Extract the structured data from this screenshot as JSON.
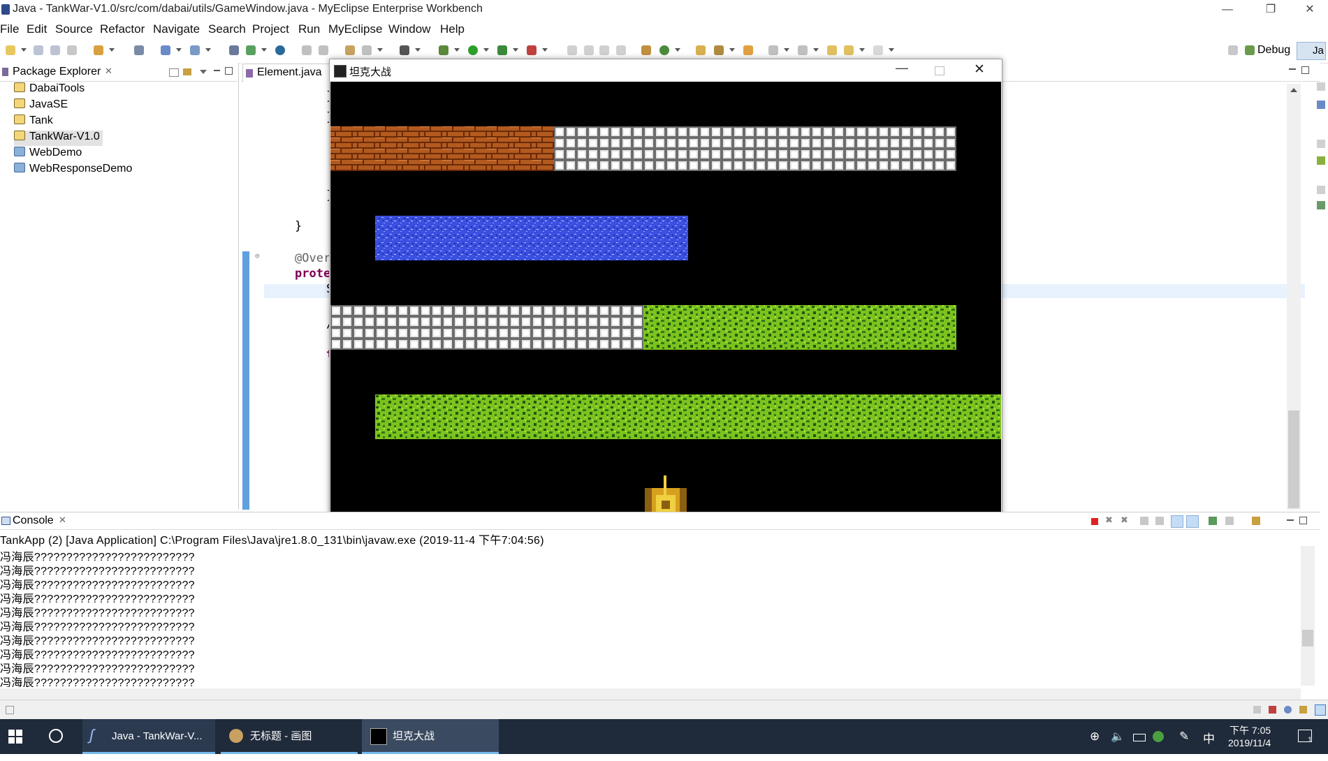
{
  "window": {
    "title": "Java - TankWar-V1.0/src/com/dabai/utils/GameWindow.java - MyEclipse Enterprise Workbench",
    "minimize": "—",
    "restore": "❐",
    "close": "✕"
  },
  "menu": [
    "File",
    "Edit",
    "Source",
    "Refactor",
    "Navigate",
    "Search",
    "Project",
    "Run",
    "MyEclipse",
    "Window",
    "Help"
  ],
  "perspectives": {
    "debug": "Debug",
    "java": "Ja"
  },
  "package_explorer": {
    "tab_title": "Package Explorer",
    "projects": [
      "DabaiTools",
      "JavaSE",
      "Tank",
      "TankWar-V1.0",
      "WebDemo",
      "WebResponseDemo"
    ],
    "selected": "TankWar-V1.0"
  },
  "editor": {
    "tab_title": "Element.java",
    "code_lines": [
      "}",
      "}",
      "}",
      "}",
      "@Over",
      "prote",
      "S",
      "/",
      "t"
    ]
  },
  "game": {
    "title": "坦克大战",
    "colors": {
      "brick": "#b35a1f",
      "steel": "#b4b4b4",
      "water": "#3b4fe0",
      "grass": "#7dc21e"
    }
  },
  "console": {
    "tab_title": "Console",
    "launch": "TankApp (2) [Java Application] C:\\Program Files\\Java\\jre1.8.0_131\\bin\\javaw.exe (2019-11-4 下午7:04:56)",
    "lines": [
      "冯海辰?????????????????????????",
      "冯海辰?????????????????????????",
      "冯海辰?????????????????????????",
      "冯海辰?????????????????????????",
      "冯海辰?????????????????????????",
      "冯海辰?????????????????????????",
      "冯海辰?????????????????????????",
      "冯海辰?????????????????????????",
      "冯海辰?????????????????????????",
      "冯海辰?????????????????????????"
    ]
  },
  "taskbar": {
    "apps": [
      "Java - TankWar-V...",
      "无标题 - 画图",
      "坦克大战"
    ],
    "ime": "中",
    "time": "下午 7:05",
    "date": "2019/11/4",
    "notifications": "1"
  }
}
